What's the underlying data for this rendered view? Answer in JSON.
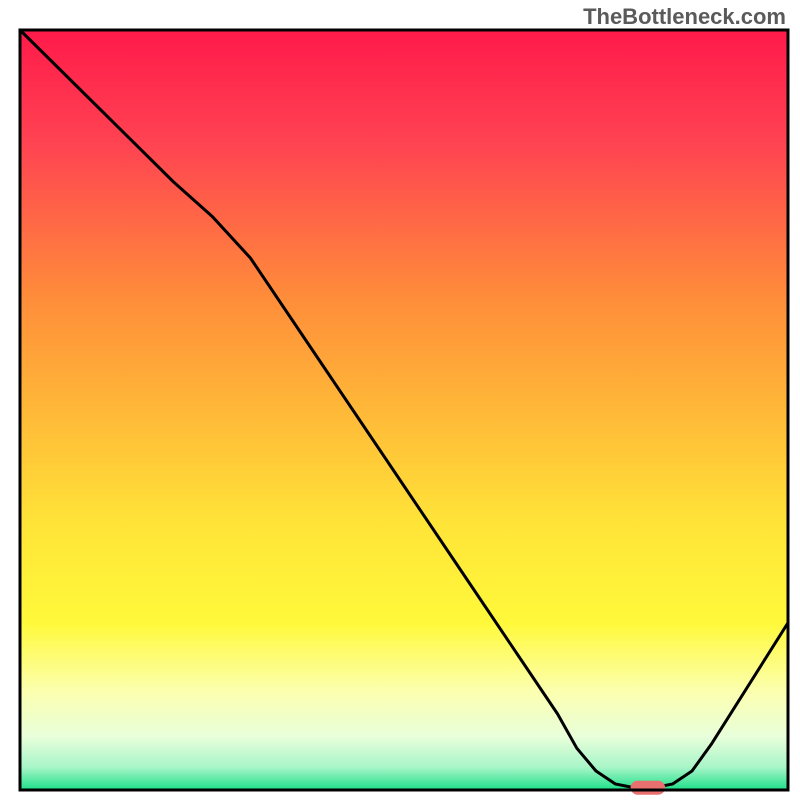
{
  "watermark": "TheBottleneck.com",
  "chart_data": {
    "type": "line",
    "x": [
      0,
      2,
      4,
      5,
      6,
      7,
      8,
      9,
      10,
      11,
      12,
      13,
      14,
      14.5,
      15,
      15.5,
      16,
      16.5,
      17,
      17.5,
      18,
      20
    ],
    "y": [
      100,
      90,
      80,
      75.5,
      70,
      62.5,
      55,
      47.5,
      40,
      32.5,
      25,
      17.5,
      10,
      5.5,
      2.5,
      0.8,
      0.3,
      0.3,
      0.8,
      2.5,
      6,
      22
    ],
    "marker": {
      "x_range": [
        15.9,
        16.8
      ],
      "y": 0.3,
      "color": "#e8716f"
    },
    "title": "",
    "xlabel": "",
    "ylabel": "",
    "xlim": [
      0,
      20
    ],
    "ylim": [
      0,
      100
    ],
    "gradient_stops": [
      {
        "offset": 0,
        "color": "#ff1a4a"
      },
      {
        "offset": 0.15,
        "color": "#ff4352"
      },
      {
        "offset": 0.35,
        "color": "#ff8c3a"
      },
      {
        "offset": 0.5,
        "color": "#ffb838"
      },
      {
        "offset": 0.65,
        "color": "#ffe438"
      },
      {
        "offset": 0.78,
        "color": "#fff93a"
      },
      {
        "offset": 0.87,
        "color": "#fcffaf"
      },
      {
        "offset": 0.93,
        "color": "#e8ffda"
      },
      {
        "offset": 0.97,
        "color": "#a8f5c8"
      },
      {
        "offset": 1.0,
        "color": "#1ce089"
      }
    ]
  }
}
